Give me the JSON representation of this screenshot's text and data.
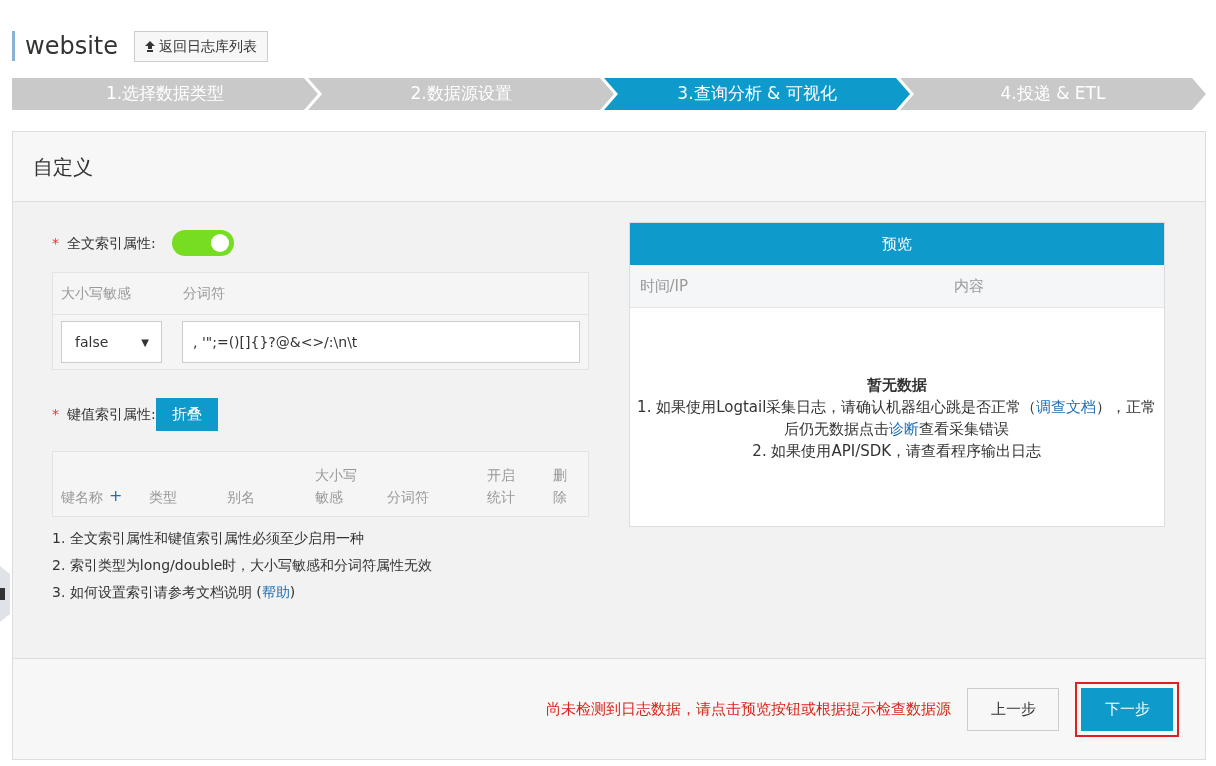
{
  "title": "website",
  "back_button": "返回日志库列表",
  "steps": [
    {
      "label": "1.选择数据类型",
      "selected": false
    },
    {
      "label": "2.数据源设置",
      "selected": false
    },
    {
      "label": "3.查询分析 & 可视化",
      "selected": true
    },
    {
      "label": "4.投递 & ETL",
      "selected": false
    }
  ],
  "card_title": "自定义",
  "fulltext": {
    "label": "全文索引属性:",
    "required_mark": "*",
    "caret": "▼",
    "on": true,
    "columns": [
      "大小写敏感",
      "分词符"
    ],
    "case_sensitive": "false",
    "delimiter": ", '\";=()[]{}?@&<>/:\\n\\t"
  },
  "keyvalue": {
    "label": "键值索引属性:",
    "required_mark": "*",
    "collapse_button": "折叠",
    "add": "+",
    "columns": [
      "键名称",
      "类型",
      "别名",
      "大小写敏感",
      "分词符",
      "开启统计",
      "删除"
    ]
  },
  "notes": [
    {
      "parts": [
        {
          "text": "1. 全文索引属性和键值索引属性必须至少启用一种",
          "kind": "text"
        }
      ]
    },
    {
      "parts": [
        {
          "text": "2. 索引类型为long/double时，大小写敏感和分词符属性无效",
          "kind": "text"
        }
      ]
    },
    {
      "parts": [
        {
          "text": "3. 如何设置索引请参考文档说明 (",
          "kind": "text"
        },
        {
          "text": "帮助",
          "kind": "link"
        },
        {
          "text": ")",
          "kind": "text"
        }
      ]
    }
  ],
  "preview": {
    "title": "预览",
    "columns": [
      "时间/IP",
      "内容"
    ],
    "empty_title": "暂无数据",
    "lines": [
      {
        "parts": [
          {
            "text": "1. 如果使用Logtail采集日志，请确认机器组心跳是否正常（",
            "kind": "text"
          },
          {
            "text": "调查文档",
            "kind": "link"
          },
          {
            "text": "），正常后仍无数据点击",
            "kind": "text"
          },
          {
            "text": "诊断",
            "kind": "link"
          },
          {
            "text": "查看采集错误",
            "kind": "text"
          }
        ]
      },
      {
        "parts": [
          {
            "text": "2. 如果使用API/SDK，请查看程序输出日志",
            "kind": "text"
          }
        ]
      }
    ]
  },
  "footer": {
    "warning": "尚未检测到日志数据，请点击预览按钮或根据提示检查数据源",
    "buttons": [
      {
        "label": "上一步",
        "kind": "default",
        "highlighted": false
      },
      {
        "label": "下一步",
        "kind": "primary",
        "highlighted": true
      }
    ]
  }
}
